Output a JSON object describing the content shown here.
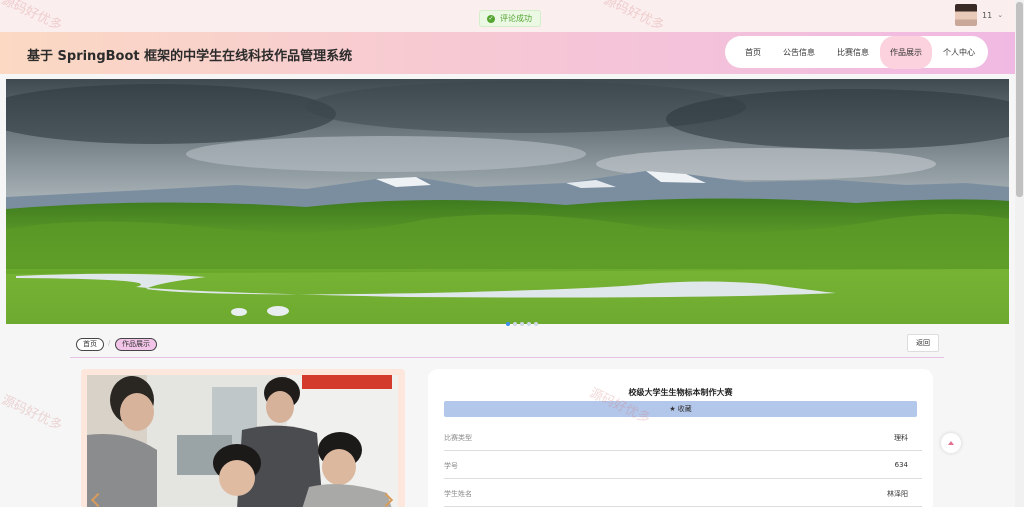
{
  "toast": {
    "text": "评论成功"
  },
  "user": {
    "name": "11"
  },
  "header": {
    "title": "基于 SpringBoot 框架的中学生在线科技作品管理系统"
  },
  "nav": [
    {
      "label": "首页",
      "active": false
    },
    {
      "label": "公告信息",
      "active": false
    },
    {
      "label": "比赛信息",
      "active": false
    },
    {
      "label": "作品展示",
      "active": true
    },
    {
      "label": "个人中心",
      "active": false
    }
  ],
  "breadcrumb": {
    "home": "首页",
    "current": "作品展示"
  },
  "back_label": "返回",
  "detail": {
    "title": "校级大学生生物标本制作大赛",
    "favorite_label": "收藏",
    "rows": [
      {
        "key": "比赛类型",
        "value": "理科"
      },
      {
        "key": "学号",
        "value": "634"
      },
      {
        "key": "学生姓名",
        "value": "林泽阳"
      }
    ]
  },
  "watermark": "源码好优多",
  "colors": {
    "accent_pink": "#f2c4e8",
    "fav_blue": "#b3c7ea",
    "success_green": "#55a532"
  }
}
